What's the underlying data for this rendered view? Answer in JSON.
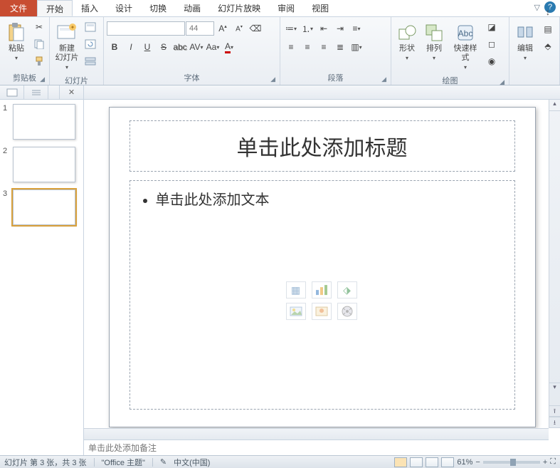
{
  "tabs": {
    "file": "文件",
    "items": [
      "开始",
      "插入",
      "设计",
      "切换",
      "动画",
      "幻灯片放映",
      "审阅",
      "视图"
    ],
    "active_index": 0
  },
  "ribbon": {
    "clipboard": {
      "label": "剪贴板",
      "paste": "粘贴"
    },
    "slides": {
      "label": "幻灯片",
      "new_slide": "新建\n幻灯片"
    },
    "font": {
      "label": "字体",
      "name_placeholder": "",
      "size_placeholder": "44"
    },
    "paragraph": {
      "label": "段落"
    },
    "drawing": {
      "label": "绘图",
      "shape": "形状",
      "arrange": "排列",
      "quickstyle": "快速样式"
    },
    "editing": {
      "label": "编辑"
    }
  },
  "thumbs": {
    "count": 3,
    "selected": 3
  },
  "slide": {
    "title_placeholder": "单击此处添加标题",
    "body_placeholder": "单击此处添加文本"
  },
  "notes": {
    "placeholder": "单击此处添加备注"
  },
  "status": {
    "slide_info": "幻灯片 第 3 张，共 3 张",
    "theme": "\"Office 主题\"",
    "lang": "中文(中国)",
    "zoom": "61%"
  }
}
